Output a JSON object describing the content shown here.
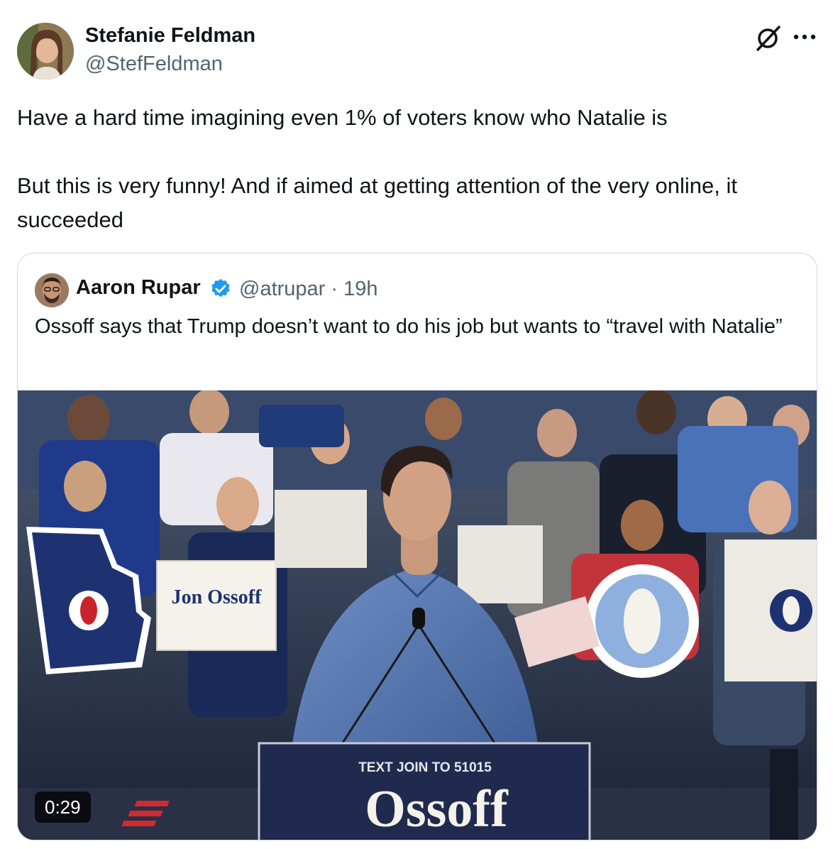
{
  "author": {
    "name": "Stefanie Feldman",
    "handle": "@StefFeldman"
  },
  "tweet": {
    "line1": "Have a hard time imagining even 1% of voters know who Natalie is",
    "line2": "But this is very funny! And if aimed at getting attention of the very online, it succeeded"
  },
  "quote": {
    "name": "Aaron Rupar",
    "handle": "@atrupar",
    "separator": "·",
    "time": "19h",
    "text": "Ossoff says that Trump doesn’t want to do his job but wants to “travel with Natalie”",
    "video": {
      "duration": "0:29",
      "podium_line": "TEXT JOIN TO 51015",
      "podium_name": "Ossoff",
      "sign_text": "Jon Ossoff"
    }
  },
  "icons": {
    "grok": "grok-icon",
    "more": "more-icon",
    "verified": "verified-badge-icon"
  },
  "colors": {
    "text": "#0f1419",
    "secondary": "#536471",
    "verified": "#1d9bf0",
    "border": "#cfd9de"
  }
}
